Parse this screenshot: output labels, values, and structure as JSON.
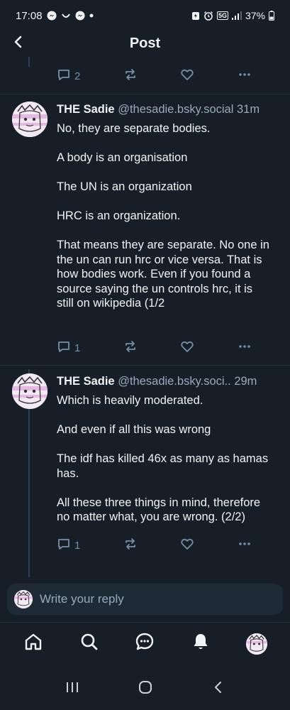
{
  "status_bar": {
    "time": "17:08",
    "battery": "37%",
    "network": "5G",
    "icons": [
      "messenger-icon",
      "smile-icon",
      "messenger-icon",
      "dot-icon",
      "battery-saver-icon",
      "alarm-icon",
      "signal-icon",
      "battery-icon"
    ]
  },
  "header": {
    "title": "Post",
    "back_icon": "chevron-left-icon"
  },
  "previous_post": {
    "reply_count": "2",
    "icons": [
      "reply-icon",
      "repost-icon",
      "like-icon",
      "more-icon"
    ]
  },
  "posts": [
    {
      "author": "THE Sadie",
      "handle": "@thesadie.bsky.social",
      "time": "31m",
      "paragraphs": [
        "No, they are separate bodies.",
        "A body is an organisation",
        "The UN is an organization",
        "HRC is an organization.",
        "That means they are separate. No one in the un can run hrc or vice versa. That is how bodies work. Even if you found a source saying the un controls hrc, it is still on wikipedia (1/2"
      ],
      "reply_count": "1"
    },
    {
      "author": "THE Sadie",
      "handle": "@thesadie.bsky.soci..",
      "time": "29m",
      "paragraphs": [
        "Which is heavily moderated.",
        "And even if all this was wrong",
        "The idf has killed 46x as many as hamas has.",
        "All these three things in mind, therefore no matter what, you are wrong. (2/2)"
      ],
      "reply_count": "1"
    }
  ],
  "reply_bar": {
    "placeholder": "Write your reply"
  },
  "bottom_nav": {
    "items": [
      "home-icon",
      "search-icon",
      "chat-icon",
      "notifications-icon",
      "profile-avatar"
    ]
  },
  "system_nav": {
    "items": [
      "recent-apps-icon",
      "home-circle-icon",
      "back-icon"
    ]
  },
  "colors": {
    "background": "#161e27",
    "text": "#f1f3f5",
    "muted": "#9aaabb",
    "icon": "#788ea5",
    "thread_line": "#2e4052"
  }
}
